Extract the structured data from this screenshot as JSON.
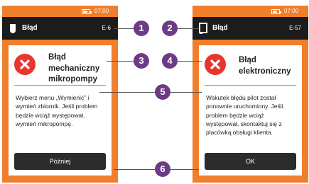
{
  "colors": {
    "accent": "#f07f2d",
    "header": "#1c1c1c",
    "error_red": "#e8352e",
    "callout": "#6d3b86",
    "button": "#2b2b2b"
  },
  "left_screen": {
    "status": {
      "time": "07:00"
    },
    "header": {
      "icon": "cartridge-icon",
      "title": "Błąd",
      "code": "E-6"
    },
    "error": {
      "icon": "error-x-icon",
      "title": "Błąd mechaniczny mikropompy",
      "description": "Wybierz menu „Wymienić” i wymień zbiornik. Jeśli problem będzie wciąż występował, wymień mikropompę."
    },
    "button_label": "Później"
  },
  "right_screen": {
    "status": {
      "time": "07:00"
    },
    "header": {
      "icon": "device-icon",
      "title": "Błąd",
      "code": "E-57"
    },
    "error": {
      "icon": "error-x-icon",
      "title": "Błąd elektroniczny",
      "description": "Wskutek błędu pilot został ponownie uruchomiony. Jeśli problem będzie wciąż występował, skontaktuj się z placówką obsługi klienta."
    },
    "button_label": "OK"
  },
  "callouts": [
    "1",
    "2",
    "3",
    "4",
    "5",
    "6"
  ]
}
